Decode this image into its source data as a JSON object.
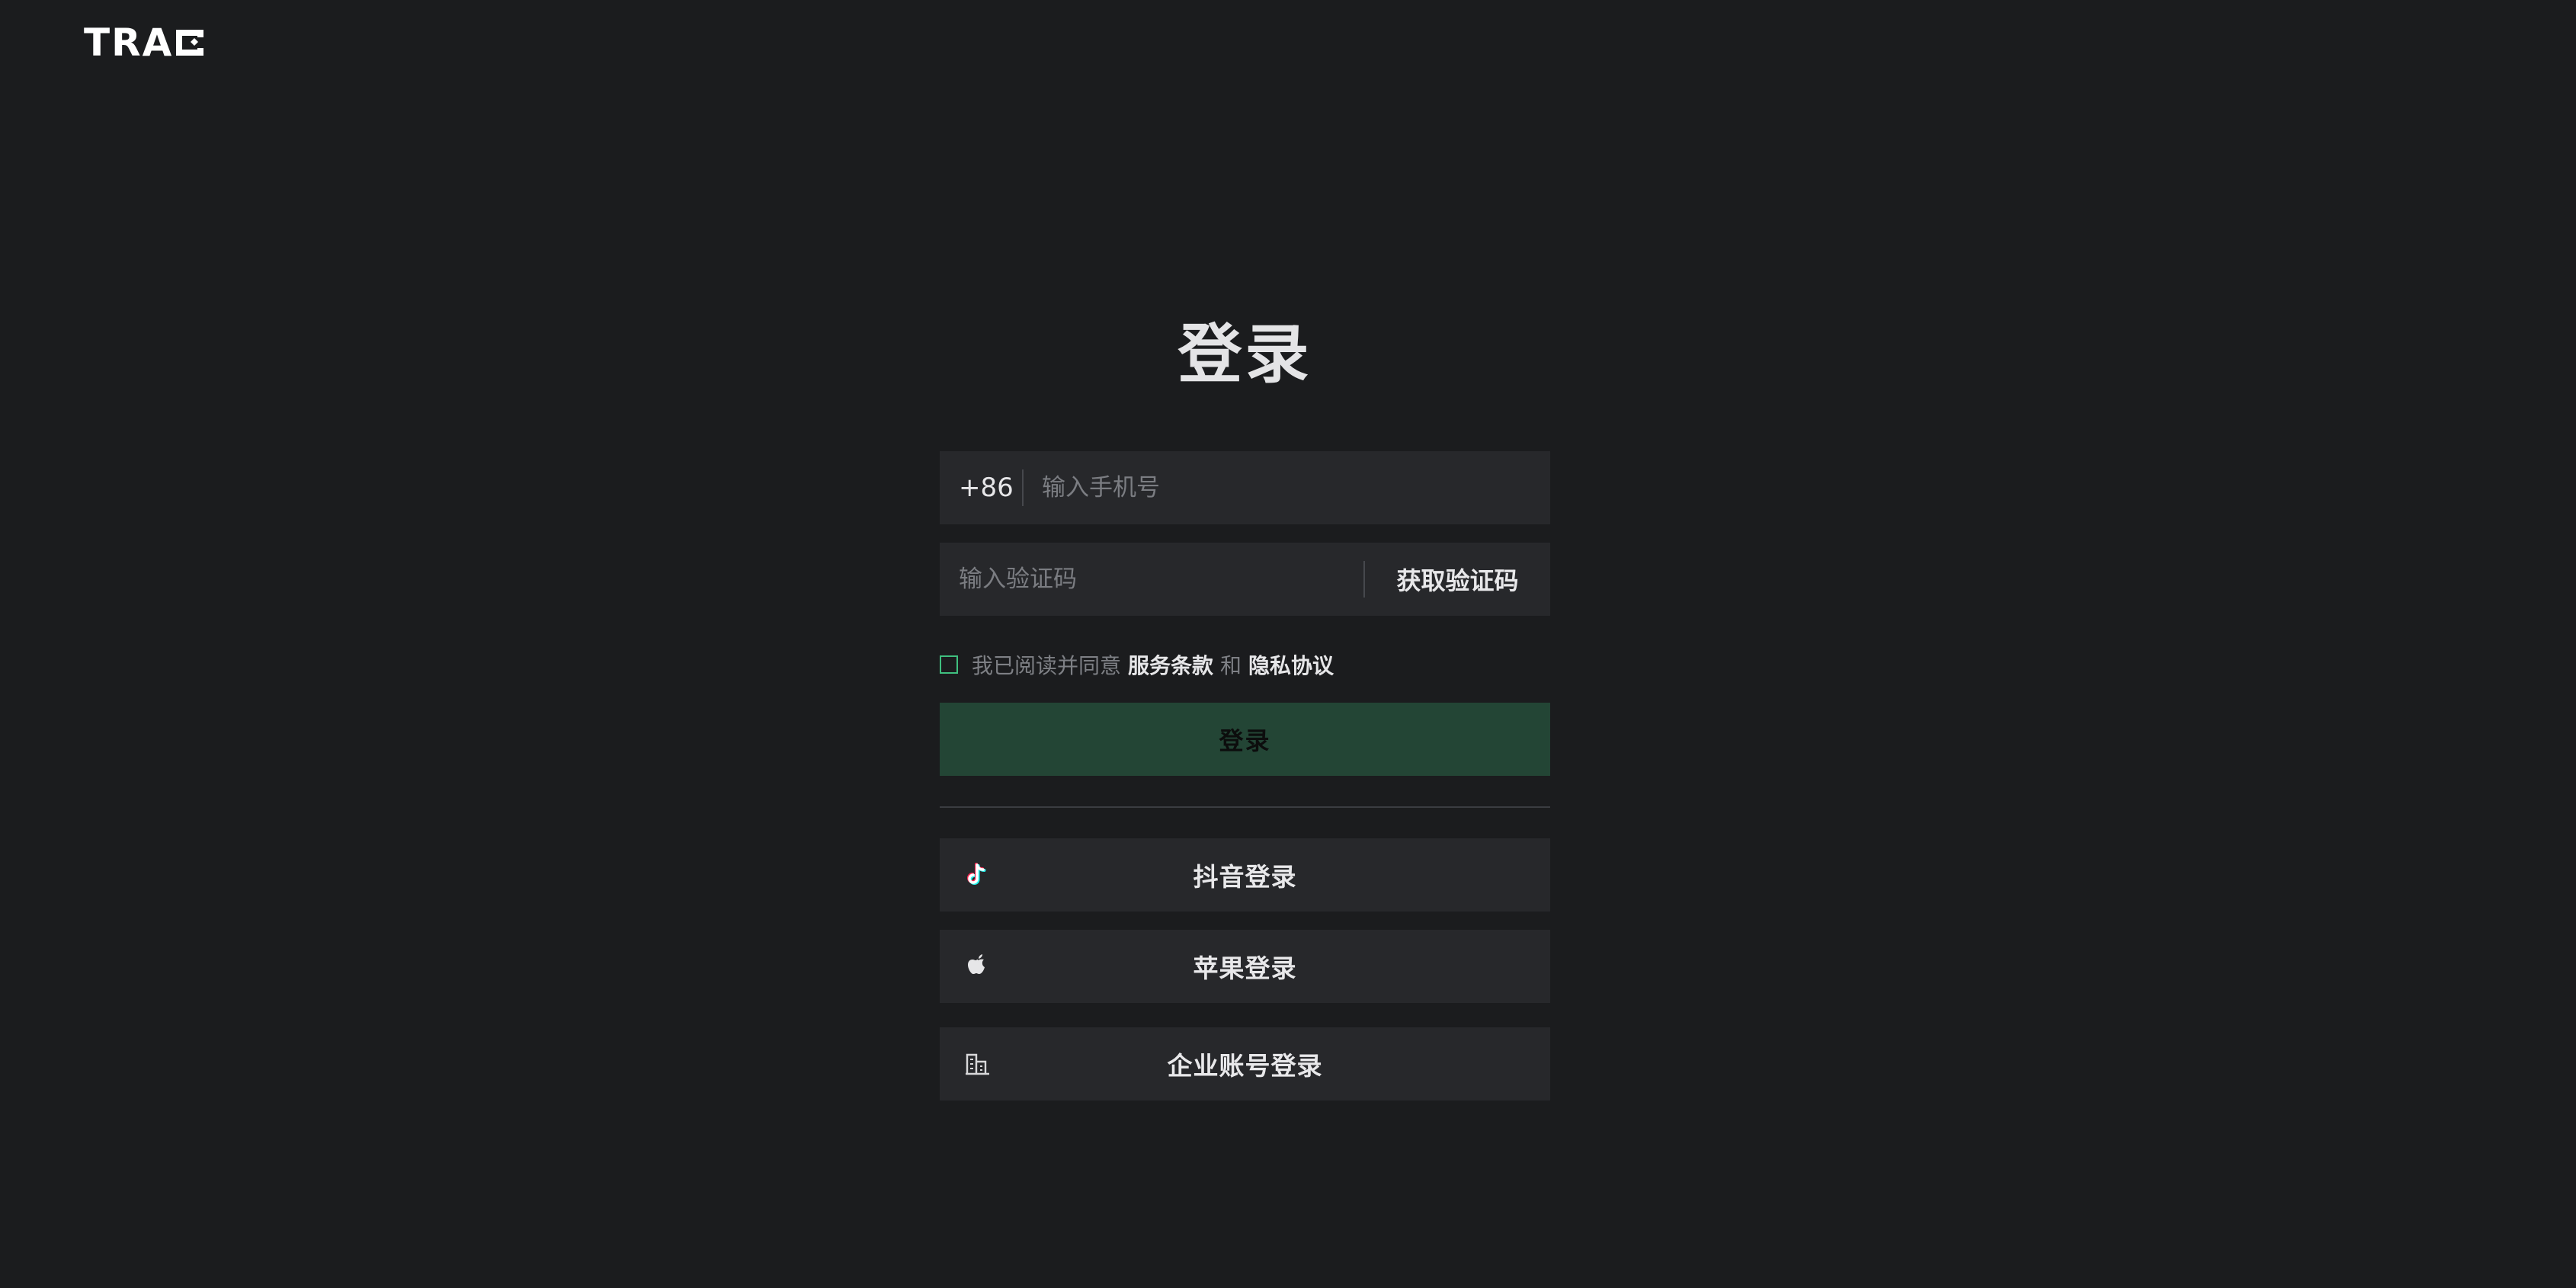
{
  "brand": {
    "logo_text": "TRA"
  },
  "login": {
    "title": "登录",
    "phone": {
      "country_code": "+86",
      "placeholder": "输入手机号",
      "value": ""
    },
    "code": {
      "placeholder": "输入验证码",
      "value": "",
      "get_code_label": "获取验证码"
    },
    "agreement": {
      "prefix": "我已阅读并同意",
      "terms_label": "服务条款",
      "conjunction": "和",
      "privacy_label": "隐私协议",
      "checked": false
    },
    "submit_label": "登录",
    "alternatives": [
      {
        "label": "抖音登录",
        "icon": "douyin-icon"
      },
      {
        "label": "苹果登录",
        "icon": "apple-icon"
      },
      {
        "label": "企业账号登录",
        "icon": "building-icon"
      }
    ]
  },
  "colors": {
    "background": "#1b1c1e",
    "field_background": "#27282b",
    "submit_background": "#234535",
    "checkbox_border": "#3fbf7f"
  }
}
